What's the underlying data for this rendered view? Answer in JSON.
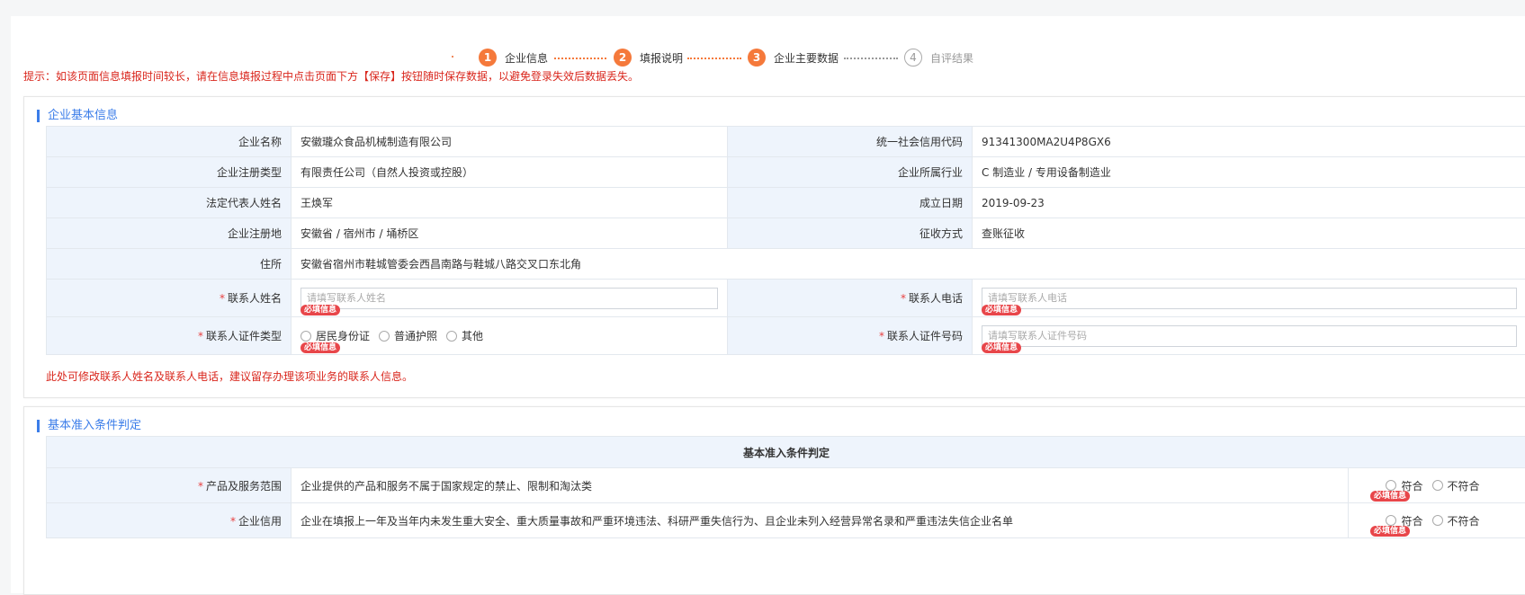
{
  "steps": [
    {
      "num": "1",
      "label": "企业信息",
      "state": "active"
    },
    {
      "num": "2",
      "label": "填报说明",
      "state": "active"
    },
    {
      "num": "3",
      "label": "企业主要数据",
      "state": "active"
    },
    {
      "num": "4",
      "label": "自评结果",
      "state": "inactive"
    }
  ],
  "tip": "提示：如该页面信息填报时间较长，请在信息填报过程中点击页面下方【保存】按钮随时保存数据，以避免登录失效后数据丢失。",
  "basic": {
    "title": "企业基本信息",
    "rows": {
      "company_name_label": "企业名称",
      "company_name": "安徽瓏众食品机械制造有限公司",
      "credit_code_label": "统一社会信用代码",
      "credit_code": "91341300MA2U4P8GX6",
      "reg_type_label": "企业注册类型",
      "reg_type": "有限责任公司（自然人投资或控股）",
      "industry_label": "企业所属行业",
      "industry": "C 制造业 / 专用设备制造业",
      "legal_rep_label": "法定代表人姓名",
      "legal_rep": "王焕军",
      "est_date_label": "成立日期",
      "est_date": "2019-09-23",
      "reg_place_label": "企业注册地",
      "reg_place": "安徽省 / 宿州市 / 埇桥区",
      "tax_method_label": "征收方式",
      "tax_method": "查账征收",
      "address_label": "住所",
      "address": "安徽省宿州市鞋城管委会西昌南路与鞋城八路交叉口东北角"
    },
    "contact_name_label": "联系人姓名",
    "contact_name_placeholder": "请填写联系人姓名",
    "contact_phone_label": "联系人电话",
    "contact_phone_placeholder": "请填写联系人电话",
    "id_type_label": "联系人证件类型",
    "id_types": [
      "居民身份证",
      "普通护照",
      "其他"
    ],
    "id_no_label": "联系人证件号码",
    "id_no_placeholder": "请填写联系人证件号码",
    "required_badge": "必填信息",
    "required_mark": "*",
    "note": "此处可修改联系人姓名及联系人电话，建议留存办理该项业务的联系人信息。"
  },
  "admission": {
    "title": "基本准入条件判定",
    "table_header": "基本准入条件判定",
    "rows": [
      {
        "label": "产品及服务范围",
        "text": "企业提供的产品和服务不属于国家规定的禁止、限制和淘汰类"
      },
      {
        "label": "企业信用",
        "text": "企业在填报上一年及当年内未发生重大安全、重大质量事故和严重环境违法、科研严重失信行为、且企业未列入经营异常名录和严重违法失信企业名单"
      }
    ],
    "options": [
      "符合",
      "不符合"
    ]
  },
  "colors": {
    "accent": "#f5793b",
    "title_blue": "#3b7de9",
    "warn_red": "#d9261c",
    "label_bg": "#eef4fc"
  }
}
